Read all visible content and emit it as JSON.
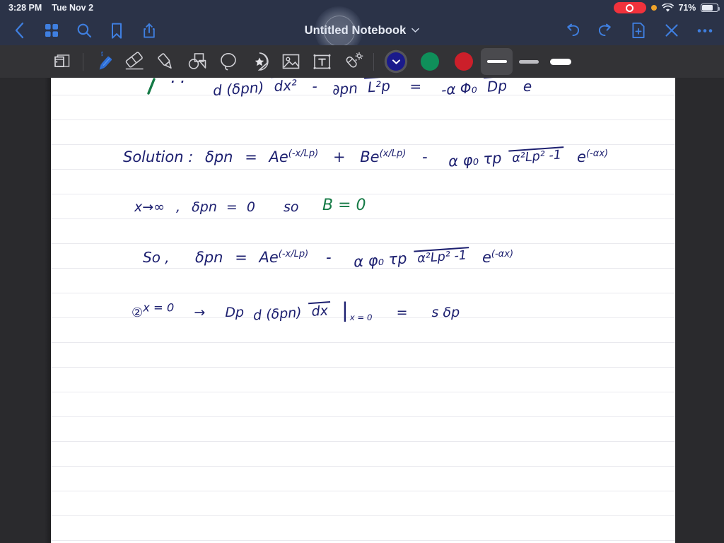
{
  "status_bar": {
    "time": "3:28 PM",
    "date": "Tue Nov 2",
    "battery_percent": "71%",
    "battery_level": 71,
    "icons": [
      "screen-recording-indicator",
      "orange-privacy-dot",
      "wifi-icon",
      "battery-icon"
    ],
    "background_color": "#2b3348"
  },
  "nav_bar": {
    "title": "Untitled Notebook",
    "title_chevron": "chevron-down",
    "left_buttons": [
      {
        "name": "back-button",
        "icon": "chevron-left-icon"
      },
      {
        "name": "page-grid-button",
        "icon": "grid-icon"
      },
      {
        "name": "search-button",
        "icon": "search-icon"
      },
      {
        "name": "bookmark-button",
        "icon": "bookmark-icon"
      },
      {
        "name": "share-button",
        "icon": "share-icon"
      }
    ],
    "right_buttons": [
      {
        "name": "undo-button",
        "icon": "undo-arrow-icon"
      },
      {
        "name": "redo-button",
        "icon": "redo-arrow-icon"
      },
      {
        "name": "add-page-button",
        "icon": "document-plus-icon"
      },
      {
        "name": "close-button",
        "icon": "close-x-icon"
      },
      {
        "name": "more-options-button",
        "icon": "ellipsis-icon"
      }
    ],
    "accent_color": "#3f7fe0",
    "background_color": "#2b3348"
  },
  "tool_bar": {
    "background_color": "#333336",
    "tools": [
      {
        "name": "page-layout-tool",
        "icon": "page-layout-icon",
        "active": false
      },
      {
        "name": "pen-tool",
        "icon": "pen-icon",
        "active": true
      },
      {
        "name": "eraser-tool",
        "icon": "eraser-icon",
        "active": false
      },
      {
        "name": "highlighter-tool",
        "icon": "highlighter-icon",
        "active": false
      },
      {
        "name": "shapes-tool",
        "icon": "shapes-icon",
        "active": false
      },
      {
        "name": "lasso-tool",
        "icon": "lasso-icon",
        "active": false
      },
      {
        "name": "sticker-tool",
        "icon": "sticker-star-icon",
        "active": false
      },
      {
        "name": "image-tool",
        "icon": "image-icon",
        "active": false
      },
      {
        "name": "text-tool",
        "icon": "text-box-icon",
        "active": false
      },
      {
        "name": "magic-tool",
        "icon": "magic-wand-icon",
        "active": false
      }
    ],
    "colors": [
      {
        "name": "color-navy",
        "hex": "#1a1a8c",
        "selected": true
      },
      {
        "name": "color-green",
        "hex": "#0f8f5a",
        "selected": false
      },
      {
        "name": "color-red",
        "hex": "#cc1f2a",
        "selected": false
      }
    ],
    "stroke_widths": [
      {
        "name": "stroke-thin",
        "px": 4,
        "selected": true
      },
      {
        "name": "stroke-medium",
        "px": 5,
        "selected": false
      },
      {
        "name": "stroke-thick",
        "px": 9,
        "selected": false
      }
    ]
  },
  "page": {
    "background_color": "#ffffff",
    "rule_color": "#e9e9ee",
    "rule_spacing_px": 35,
    "ink_navy": "#1d2070",
    "ink_green": "#157a46",
    "notes": {
      "line0_fragment": "··",
      "line1": {
        "lhs_num": "d (δpn)",
        "lhs_den": "dx²",
        "minus": "-",
        "term_num": "∂pn",
        "term_den": "L²p",
        "equals": "=",
        "rhs_num": "-α Φ₀",
        "rhs_den": "Dp",
        "rhs_tail": "e"
      },
      "line2": {
        "label": "Solution :",
        "lhs": "δpn",
        "equals": "=",
        "t1_base": "Ae",
        "t1_exp": "(-x/Lp)",
        "plus": "+",
        "t2_base": "Be",
        "t2_exp": "(x/Lp)",
        "minus": "-",
        "f_num": "α φ₀ τp",
        "f_den": "α²Lp² -1",
        "t3_base": "e",
        "t3_exp": "(-αx)"
      },
      "line3": {
        "cond": "x→∞",
        "comma": ",",
        "lhs": "δpn",
        "equals": "=",
        "value": "0",
        "so": "so",
        "result": "B = 0"
      },
      "line4": {
        "so": "So ,",
        "lhs": "δpn",
        "equals": "=",
        "t1_base": "Ae",
        "t1_exp": "(-x/Lp)",
        "minus": "-",
        "f_num": "α φ₀ τp",
        "f_den": "α²Lp² -1",
        "t3_base": "e",
        "t3_exp": "(-αx)"
      },
      "line5": {
        "marker": "②",
        "cond_exp": "x = 0",
        "arrow": "→",
        "coef": "Dp",
        "f_num": "d (δpn)",
        "f_den": "dx",
        "eval_at": "x = 0",
        "equals": "=",
        "rhs": "s δp"
      }
    }
  }
}
